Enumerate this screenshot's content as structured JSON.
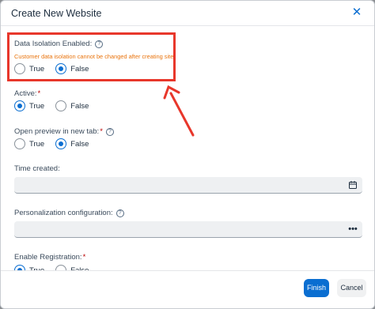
{
  "dialog": {
    "title": "Create New Website",
    "close_icon": "close-icon"
  },
  "fields": {
    "data_isolation": {
      "label": "Data Isolation Enabled:",
      "help": "?",
      "warning": "Customer data isolation cannot be changed after creating site.",
      "options": [
        "True",
        "False"
      ],
      "selected": "False"
    },
    "active": {
      "label": "Active:",
      "required_mark": "*",
      "options": [
        "True",
        "False"
      ],
      "selected": "True"
    },
    "open_preview": {
      "label": "Open preview in new tab:",
      "required_mark": "*",
      "help": "?",
      "options": [
        "True",
        "False"
      ],
      "selected": "False"
    },
    "time_created": {
      "label": "Time created:",
      "value": "",
      "icon": "calendar-icon"
    },
    "personalization": {
      "label": "Personalization configuration:",
      "help": "?",
      "value": "",
      "icon": "more-icon"
    },
    "enable_registration": {
      "label": "Enable Registration:",
      "required_mark": "*",
      "options": [
        "True",
        "False"
      ],
      "selected": "True"
    }
  },
  "footer": {
    "finish_label": "Finish",
    "cancel_label": "Cancel"
  },
  "annotation": {
    "highlight_color": "#e8372b"
  },
  "colors": {
    "accent": "#0a6ed1",
    "warning": "#e9730c",
    "required": "#bb0000"
  }
}
